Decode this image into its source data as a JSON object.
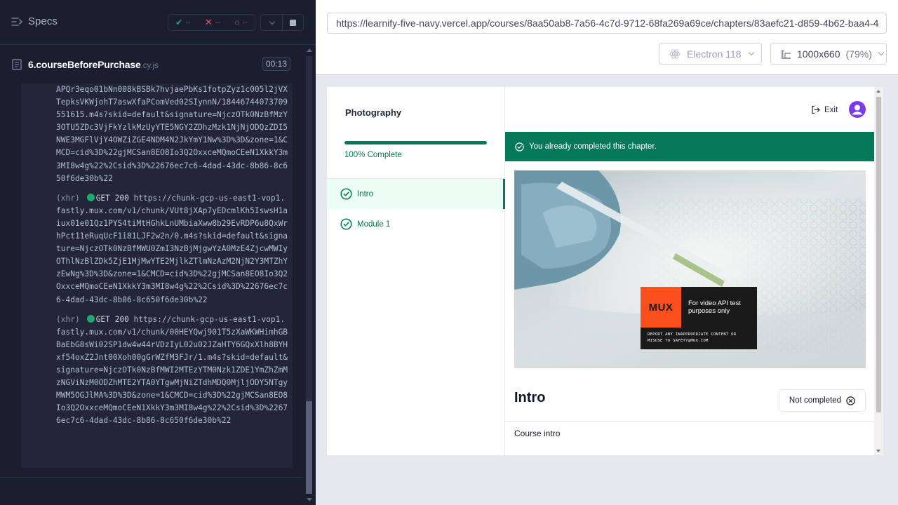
{
  "runner": {
    "specs_label": "Specs",
    "stats": {
      "passed": "--",
      "failed": "--",
      "pending": "--"
    },
    "spec_file": {
      "name": "6.courseBeforePurchase",
      "ext": ".cy.js"
    },
    "duration": "00:13"
  },
  "log": {
    "fragment": "APQr3eqo01bNn008kBSBk7hvjaePbKs1fotpZyz1c005l2jVXTepksVKWjohT7aswXfaPComVed02SIynnN/1844674407370955161​5.m4s?skid=default&signature=NjczOTk0NzBfMzY3OTU5ZDc3VjFkYzlkMzUyYTE5NGY2ZDhzMzk1NjNjODQzZDI5NWE3MGFlVjY4OWZiZGE4NDM4N2JkYmY1Nw%3D%3D&zone=1&CMCD=cid%3D%22gjMCSan8EO8Io3Q2OxxceMQmoCEeN1XkkY3m3MI8w4g%22%2Csid%3D%22676ec7c6-4dad-43dc-8b86-8c650f6de30b%22",
    "entries": [
      {
        "tag": "(xhr)",
        "method": "GET 200",
        "url": "https://chunk-gcp-us-east1-vop1.fastly.mux.com/v1/chunk/VUt8jXAp7yEDcmlKh5IswsH1aiux01e01Qz1PYS4tiMtHGhkLnUMbiaXww8b29EvRDP6u8QxWrhPct11eRuqUcF1i81LJF2w2n/0.m4s?skid=default&signature=NjczOTk0NzBfMWU0ZmI3NzBjMjgwYzA0MzE4ZjcwMWIyOThlNzBlZDk5ZjE1MjMwYTE2MjlkZTlmNzAzM2NjN2Y3MTZhYzEwNg%3D%3D&zone=1&CMCD=cid%3D%22gjMCSan8EO8Io3Q2OxxceMQmoCEeN1XkkY3m3MI8w4g%22%2Csid%3D%22676ec7c6-4dad-43dc-8b86-8c650f6de30b%22"
      },
      {
        "tag": "(xhr)",
        "method": "GET 200",
        "url": "https://chunk-gcp-us-east1-vop1.fastly.mux.com/v1/chunk/00HEYQwj901T5zXaWKWHimhGBBaEbG8sWi02SP1dw4w44rVDzIyL02u02JZaHTY6GQxXlh8BYHxf54oxZ2Jnt00Xoh00gGrWZfM3FJr/1.m4s?skid=default&signature=NjczOTk0NzBfMWI2MTEzYTM0Nzk1ZDE1YmZhZmMzNGViNzM0ODZhMTE2YTA0YTgwMjNiZTdhMDQ0MjljODY5NTgyMWM5OGJlMA%3D%3D&zone=1&CMCD=cid%3D%22gjMCSan8EO8Io3Q2OxxceMQmoCEeN1XkkY3m3MI8w4g%22%2Csid%3D%22676ec7c6-4dad-43dc-8b86-8c650f6de30b%22"
      }
    ]
  },
  "browser": {
    "url": "https://learnify-five-navy.vercel.app/courses/8aa50ab8-7a56-4c7d-9712-68fa269a69ce/chapters/83aefc21-d859-4b62-baa4-4",
    "name": "Electron 118",
    "viewport": "1000x660",
    "zoom": "(79%)"
  },
  "app": {
    "course_title": "Photography",
    "progress_value": 100,
    "progress_text": "100% Complete",
    "chapters": [
      {
        "label": "Intro"
      },
      {
        "label": "Module 1"
      }
    ],
    "exit_label": "Exit",
    "banner_text": "You already completed this chapter.",
    "video": {
      "mux_logo": "MUX",
      "mux_text": "For video API test purposes only",
      "mux_disclaimer": "REPORT ANY INAPPROPRIATE CONTENT OR MISUSE TO SAFETY@MUX.COM"
    },
    "chapter_title": "Intro",
    "completion_button": "Not completed",
    "chapter_description": "Course intro"
  },
  "colors": {
    "accent_green": "#047857",
    "runner_bg": "#1b1e2e",
    "mux_orange": "#fb501d"
  }
}
